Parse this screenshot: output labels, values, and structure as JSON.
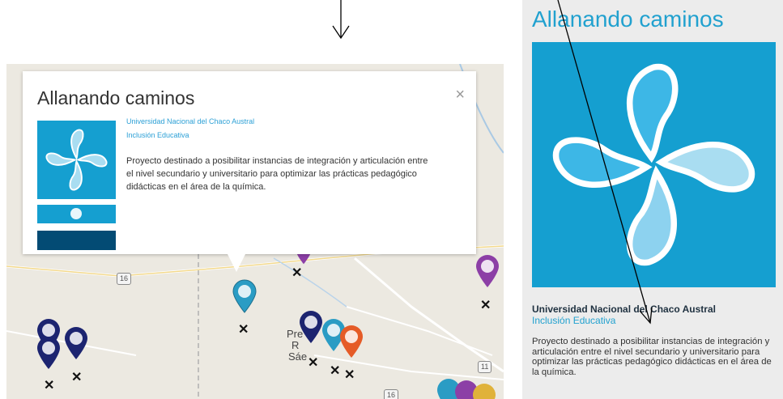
{
  "popup": {
    "title": "Allanando caminos",
    "close": "×",
    "institution": "Universidad Nacional del Chaco Austral",
    "category": "Inclusión Educativa",
    "description": "Proyecto destinado a posibilitar instancias de integración y articulación entre el nivel secundario y universitario para optimizar las prácticas pedagógico didácticas en el área de la química."
  },
  "map": {
    "route_shields": [
      "16",
      "11",
      "16"
    ],
    "town_lines": [
      "Pre",
      "R",
      "Sáe"
    ],
    "marker_colors": {
      "cyan": "#2a9cc4",
      "navy": "#1c2470",
      "purple": "#8c3fa6",
      "orange": "#e55b27"
    }
  },
  "card": {
    "title": "Allanando caminos",
    "institution": "Universidad Nacional del Chaco Austral",
    "category": "Inclusión Educativa",
    "description": "Proyecto destinado a posibilitar instancias de integración y articulación entre el nivel secundario y universitario para optimizar las prácticas pedagógico didácticas en el área de la química."
  },
  "icons": {
    "logo": "star-swirl-logo-icon",
    "marker": "map-pin-icon",
    "close": "close-icon"
  }
}
